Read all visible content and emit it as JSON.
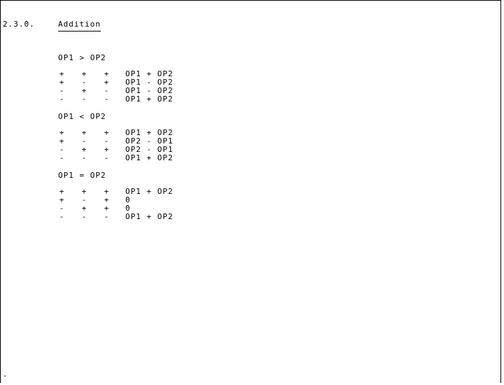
{
  "section": {
    "number": "2.3.0.",
    "title": "Addition"
  },
  "groups": [
    {
      "heading": "OP1 > OP2",
      "rows": [
        {
          "a": "+",
          "b": "+",
          "c": "+",
          "result": "OP1 + OP2"
        },
        {
          "a": "+",
          "b": "-",
          "c": "+",
          "result": "OP1 - OP2"
        },
        {
          "a": "-",
          "b": "+",
          "c": "-",
          "result": "OP1 - OP2"
        },
        {
          "a": "-",
          "b": "-",
          "c": "-",
          "result": "OP1 + OP2"
        }
      ]
    },
    {
      "heading": "OP1 < OP2",
      "rows": [
        {
          "a": "+",
          "b": "+",
          "c": "+",
          "result": "OP1 + OP2"
        },
        {
          "a": "+",
          "b": "-",
          "c": "-",
          "result": "OP2 - OP1"
        },
        {
          "a": "-",
          "b": "+",
          "c": "+",
          "result": "OP2 - OP1"
        },
        {
          "a": "-",
          "b": "-",
          "c": "-",
          "result": "OP1 + OP2"
        }
      ]
    },
    {
      "heading": "OP1 = OP2",
      "rows": [
        {
          "a": "+",
          "b": "+",
          "c": "+",
          "result": "OP1 + OP2"
        },
        {
          "a": "+",
          "b": "-",
          "c": "+",
          "result": "0"
        },
        {
          "a": "-",
          "b": "+",
          "c": "+",
          "result": "0"
        },
        {
          "a": "-",
          "b": "-",
          "c": "-",
          "result": "OP1 + OP2"
        }
      ]
    }
  ],
  "cursor": "-"
}
